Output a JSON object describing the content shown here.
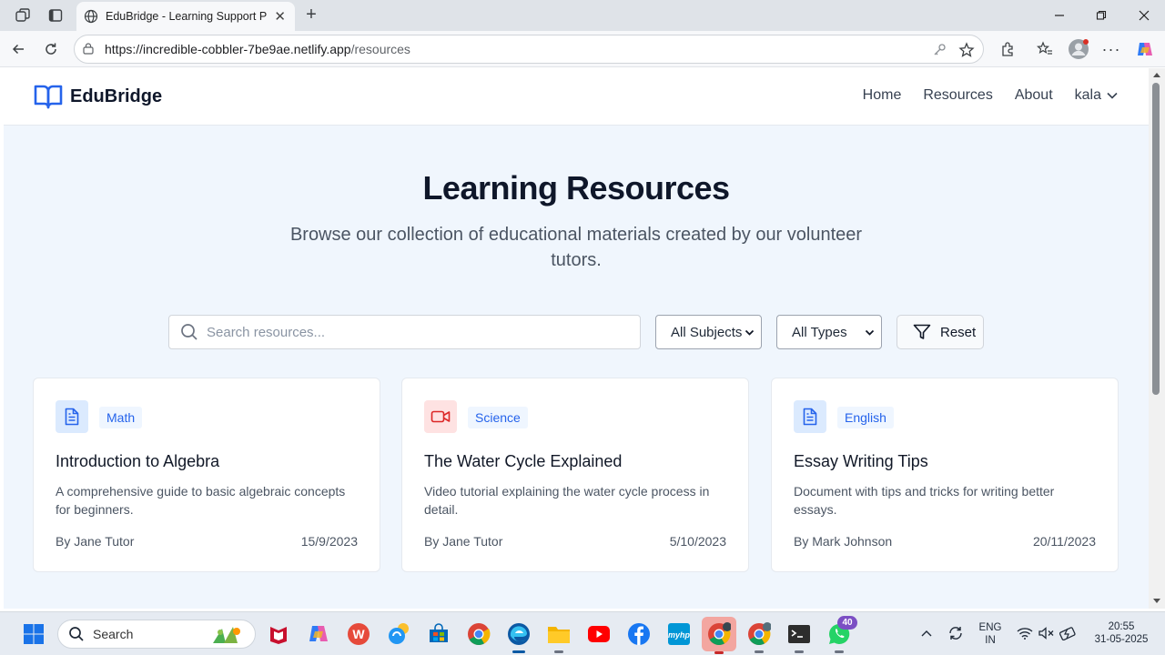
{
  "browser": {
    "tab_title": "EduBridge - Learning Support Pla",
    "url_host": "https://incredible-cobbler-7be9ae.netlify.app",
    "url_path": "/resources"
  },
  "site": {
    "brand": "EduBridge",
    "nav": [
      "Home",
      "Resources",
      "About"
    ],
    "user": "kala"
  },
  "hero": {
    "title": "Learning Resources",
    "subtitle": "Browse our collection of educational materials created by our volunteer tutors."
  },
  "filters": {
    "search_placeholder": "Search resources...",
    "subject_select": "All Subjects",
    "type_select": "All Types",
    "reset_label": "Reset"
  },
  "resources": [
    {
      "icon": "document-icon",
      "subject": "Math",
      "title": "Introduction to Algebra",
      "description": "A comprehensive guide to basic algebraic concepts for beginners.",
      "author": "By Jane Tutor",
      "date": "15/9/2023"
    },
    {
      "icon": "video-icon",
      "subject": "Science",
      "title": "The Water Cycle Explained",
      "description": "Video tutorial explaining the water cycle process in detail.",
      "author": "By Jane Tutor",
      "date": "5/10/2023"
    },
    {
      "icon": "document-icon",
      "subject": "English",
      "title": "Essay Writing Tips",
      "description": "Document with tips and tricks for writing better essays.",
      "author": "By Mark Johnson",
      "date": "20/11/2023"
    }
  ],
  "taskbar": {
    "search_label": "Search",
    "whatsapp_badge": "40",
    "language": "ENG",
    "region": "IN",
    "time": "20:55",
    "date": "31-05-2025"
  },
  "colors": {
    "accent": "#2563eb",
    "page_bg": "#f0f6fd",
    "video_icon": "#dc2626"
  }
}
